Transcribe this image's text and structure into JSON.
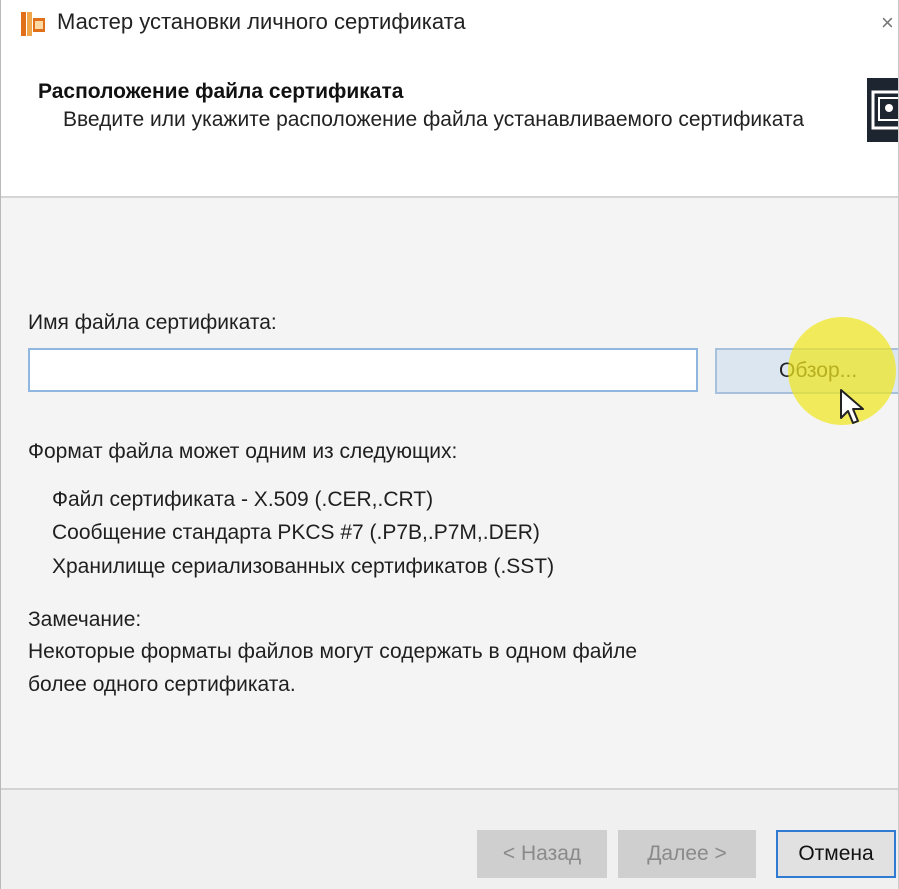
{
  "window": {
    "title": "Мастер установки личного сертификата",
    "close_glyph": "×"
  },
  "header": {
    "title": "Расположение файла сертификата",
    "subtitle": "Введите или укажите расположение файла устанавливаемого сертификата"
  },
  "form": {
    "file_label": "Имя файла сертификата:",
    "file_value": "",
    "file_placeholder": "",
    "browse_label": "Обзор..."
  },
  "formats": {
    "intro": "Формат файла может одним из следующих:",
    "items": [
      "Файл сертификата - X.509 (.CER,.CRT)",
      "Сообщение стандарта PKCS #7 (.P7B,.P7M,.DER)",
      "Хранилище сериализованных сертификатов (.SST)"
    ]
  },
  "note": {
    "heading": "Замечание:",
    "line1": "Некоторые форматы файлов могут содержать в одном файле",
    "line2": "более одного сертификата."
  },
  "footer": {
    "back_label": "< Назад",
    "next_label": "Далее >",
    "cancel_label": "Отмена"
  },
  "colors": {
    "accent": "#2f7bd4",
    "highlight": "#f0e61e",
    "icon_orange": "#e0701a"
  },
  "icons": [
    "certificate-app-icon",
    "close-icon",
    "certificate-header-icon",
    "mouse-pointer-icon"
  ]
}
